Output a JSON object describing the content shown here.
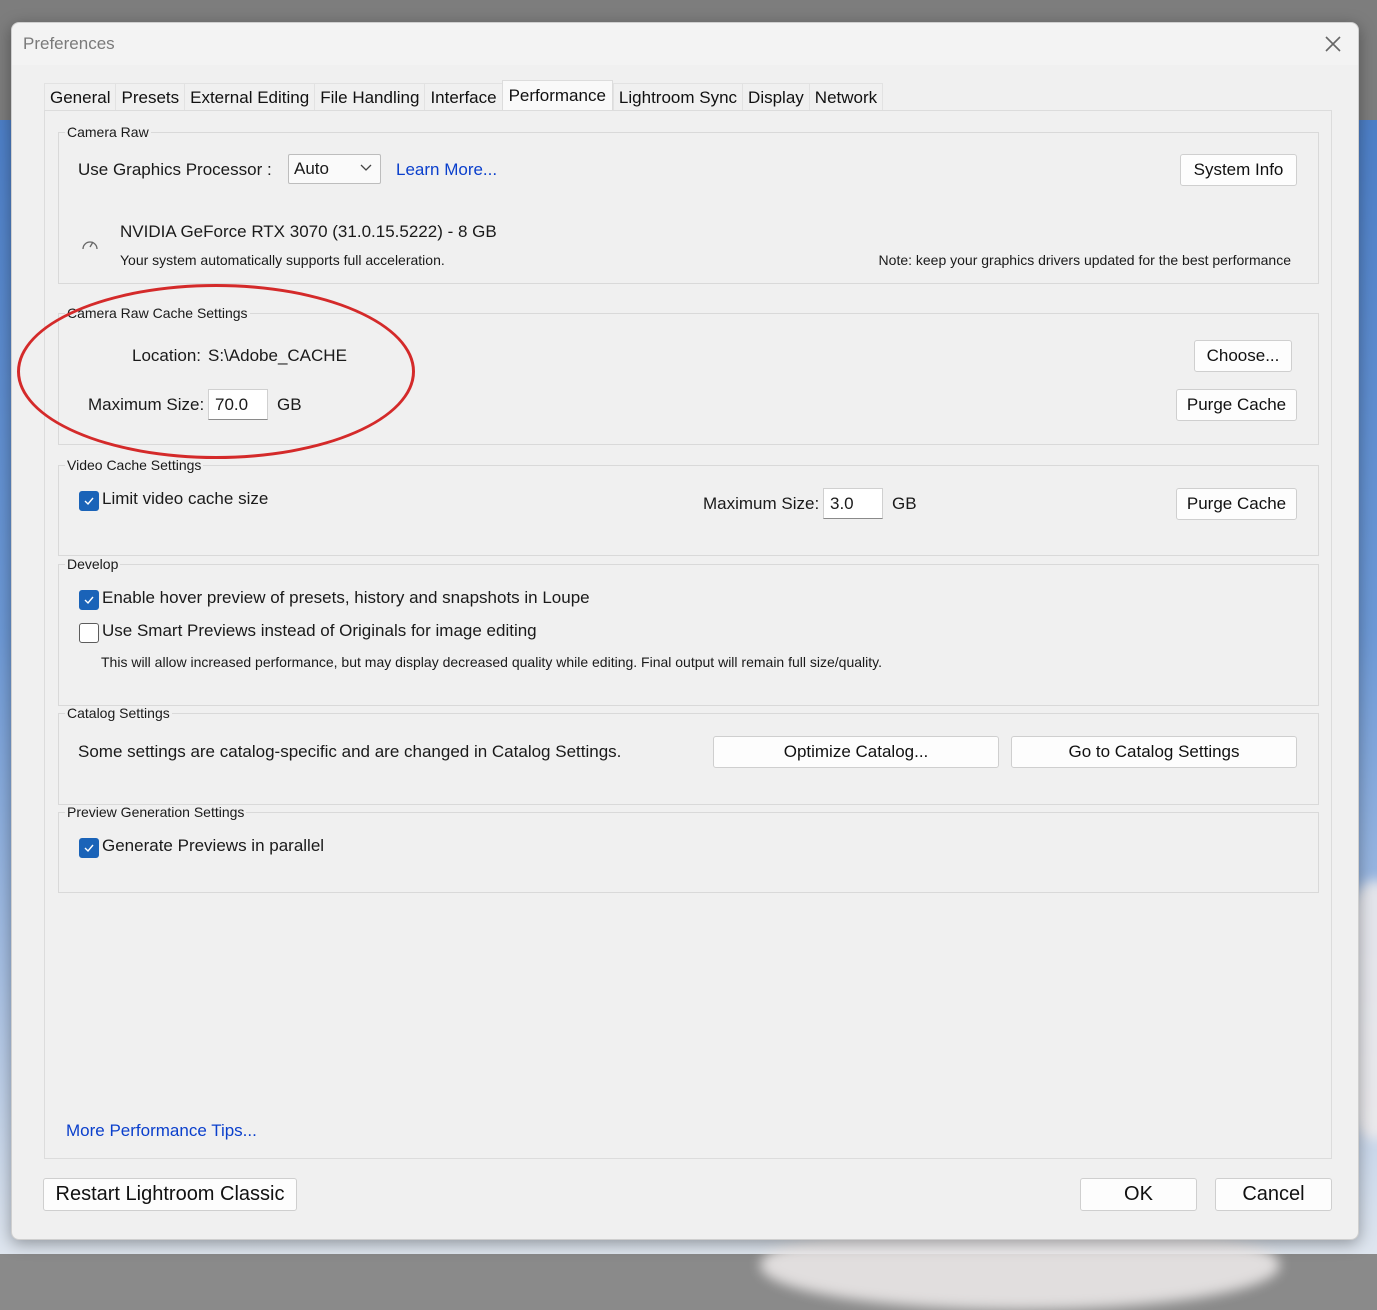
{
  "window": {
    "title": "Preferences"
  },
  "tabs": [
    {
      "label": "General"
    },
    {
      "label": "Presets"
    },
    {
      "label": "External Editing"
    },
    {
      "label": "File Handling"
    },
    {
      "label": "Interface"
    },
    {
      "label": "Performance"
    },
    {
      "label": "Lightroom Sync"
    },
    {
      "label": "Display"
    },
    {
      "label": "Network"
    }
  ],
  "active_tab": "Performance",
  "camera_raw": {
    "legend": "Camera Raw",
    "gpu_label": "Use Graphics Processor :",
    "gpu_value": "Auto",
    "learn_more": "Learn More...",
    "system_info_button": "System Info",
    "gpu_name": "NVIDIA GeForce RTX 3070 (31.0.15.5222) - 8 GB",
    "gpu_status": "Your system automatically supports full acceleration.",
    "driver_note": "Note: keep your graphics drivers updated for the best performance"
  },
  "raw_cache": {
    "legend": "Camera Raw Cache Settings",
    "location_label": "Location:",
    "location_value": "S:\\Adobe_CACHE",
    "choose_button": "Choose...",
    "max_size_label": "Maximum Size:",
    "max_size_value": "70.0",
    "unit": "GB",
    "purge_button": "Purge Cache"
  },
  "video_cache": {
    "legend": "Video Cache Settings",
    "limit_label": "Limit video cache size",
    "limit_checked": true,
    "max_size_label": "Maximum Size:",
    "max_size_value": "3.0",
    "unit": "GB",
    "purge_button": "Purge Cache"
  },
  "develop": {
    "legend": "Develop",
    "hover_preview_label": "Enable hover preview of presets, history and snapshots in Loupe",
    "hover_preview_checked": true,
    "smart_previews_label": "Use Smart Previews instead of Originals for image editing",
    "smart_previews_checked": false,
    "smart_previews_note": "This will allow increased performance, but may display decreased quality while editing. Final output will remain full size/quality."
  },
  "catalog": {
    "legend": "Catalog Settings",
    "description": "Some settings are catalog-specific and are changed in Catalog Settings.",
    "optimize_button": "Optimize Catalog...",
    "goto_button": "Go to Catalog Settings"
  },
  "preview_generation": {
    "legend": "Preview Generation Settings",
    "parallel_label": "Generate Previews in parallel",
    "parallel_checked": true
  },
  "footer": {
    "tips_link": "More Performance Tips...",
    "restart_button": "Restart Lightroom Classic",
    "ok_button": "OK",
    "cancel_button": "Cancel"
  },
  "colors": {
    "checkbox_accent": "#1a63b8",
    "link": "#0a3fcc",
    "annotation": "#d42a2a"
  }
}
